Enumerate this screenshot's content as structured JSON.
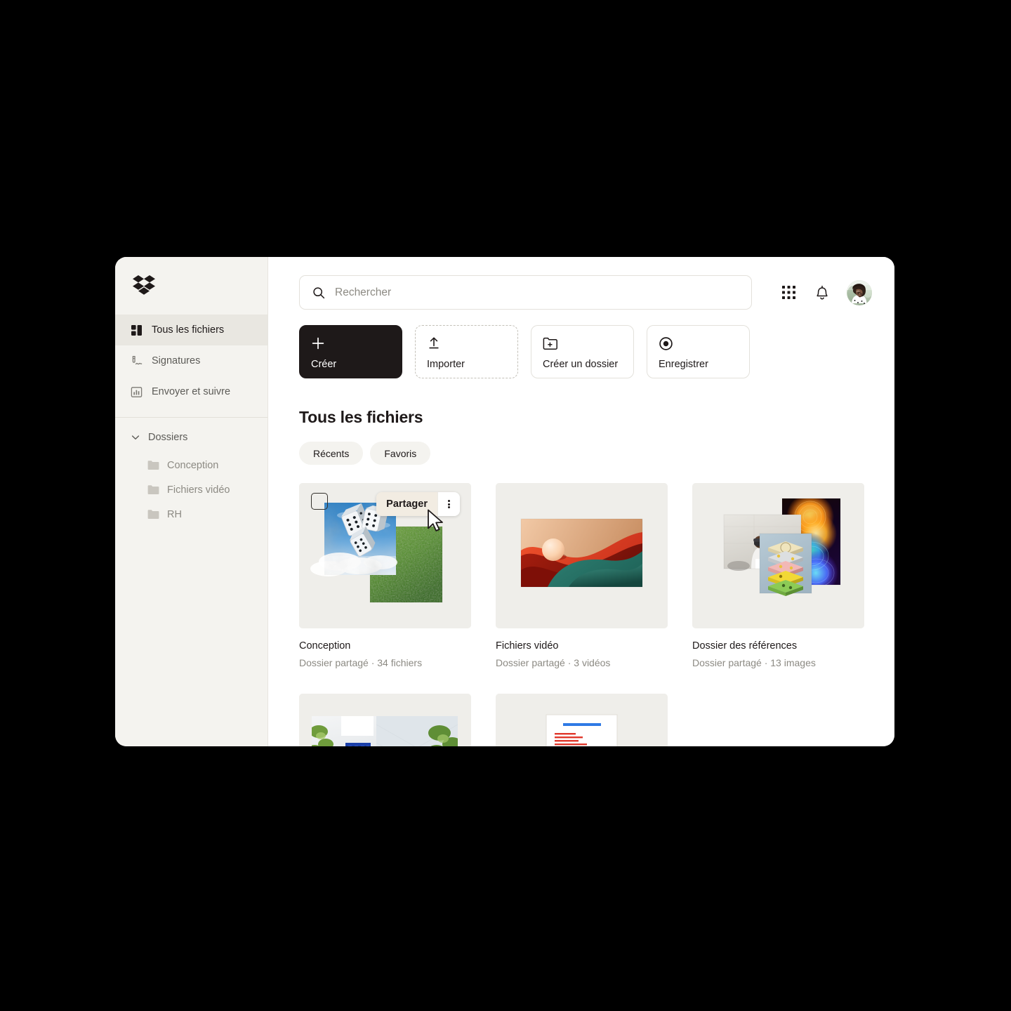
{
  "app": {
    "brand": "dropbox-logo"
  },
  "sidebar": {
    "nav": [
      {
        "label": "Tous les fichiers",
        "icon": "all-files-icon",
        "active": true
      },
      {
        "label": "Signatures",
        "icon": "signature-icon",
        "active": false
      },
      {
        "label": "Envoyer et suivre",
        "icon": "send-track-icon",
        "active": false
      }
    ],
    "folders_group": {
      "label": "Dossiers",
      "icon": "chevron-down-icon",
      "items": [
        {
          "label": "Conception",
          "icon": "folder-icon"
        },
        {
          "label": "Fichiers vidéo",
          "icon": "folder-icon"
        },
        {
          "label": "RH",
          "icon": "folder-icon"
        }
      ]
    }
  },
  "search": {
    "placeholder": "Rechercher",
    "value": "",
    "icon": "search-icon"
  },
  "topbar": {
    "apps_icon": "grid-apps-icon",
    "notifications_icon": "bell-icon",
    "avatar": "user-avatar"
  },
  "quick_actions": [
    {
      "label": "Créer",
      "icon": "plus-icon",
      "style": "primary"
    },
    {
      "label": "Importer",
      "icon": "upload-icon",
      "style": "dashed"
    },
    {
      "label": "Créer un dossier",
      "icon": "folder-plus-icon",
      "style": "outline"
    },
    {
      "label": "Enregistrer",
      "icon": "record-icon",
      "style": "outline"
    }
  ],
  "main": {
    "title": "Tous les fichiers",
    "chips": [
      {
        "label": "Récents"
      },
      {
        "label": "Favoris"
      }
    ],
    "hover_actions": {
      "share_label": "Partager",
      "kebab_icon": "more-vertical-icon",
      "cursor": "mouse-pointer-icon"
    },
    "files": [
      {
        "name": "Conception",
        "meta": "Dossier partagé · 34 fichiers",
        "thumb": "dice-and-moss-collage",
        "selected": false
      },
      {
        "name": "Fichiers vidéo",
        "meta": "Dossier partagé · 3 vidéos",
        "thumb": "abstract-red-teal-wave"
      },
      {
        "name": "Dossier des références",
        "meta": "Dossier partagé · 13 images",
        "thumb": "reference-images-stack"
      }
    ],
    "files_row2": [
      {
        "thumb": "white-architecture-blue-door"
      },
      {
        "thumb": "document-preview"
      }
    ]
  },
  "colors": {
    "window_bg": "#ffffff",
    "sidebar_bg": "#f4f3ef",
    "sidebar_active": "#e9e7e1",
    "primary_button": "#1e1919",
    "thumb_bg": "#efeeea",
    "chip_bg": "#f4f3ef",
    "muted_text": "#8c8a83",
    "page_bg": "#000000",
    "share_hover_bg": "#f2ece2"
  }
}
